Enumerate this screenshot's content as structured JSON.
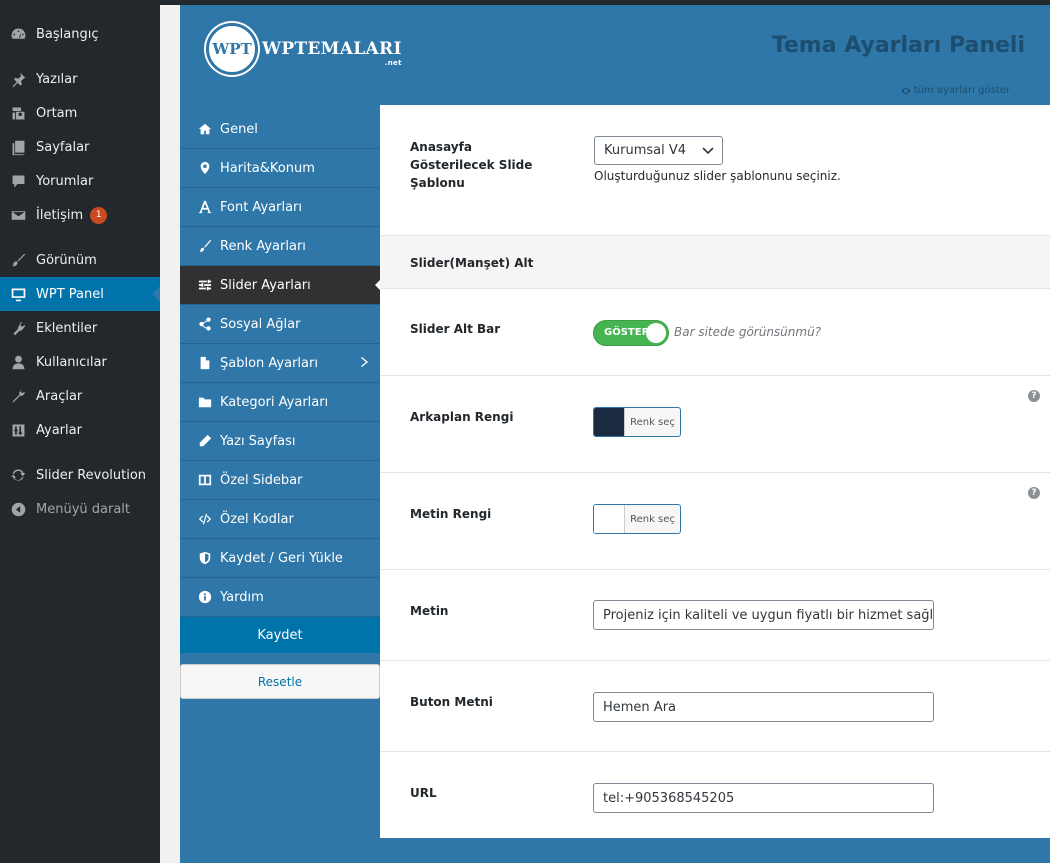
{
  "colors": {
    "wp_sidebar": "#23282d",
    "wp_active": "#0073aa",
    "panel": "#2e77a8",
    "nav_active": "#2f3133",
    "badge": "#ca4a1f",
    "toggle_on": "#46b450",
    "bg_swatch": "#1b2a40",
    "text_swatch": "#ffffff"
  },
  "wp_menu": [
    {
      "label": "Başlangıç",
      "icon": "dashboard-icon"
    },
    {
      "label": "Yazılar",
      "icon": "pin-icon"
    },
    {
      "label": "Ortam",
      "icon": "media-icon"
    },
    {
      "label": "Sayfalar",
      "icon": "pages-icon"
    },
    {
      "label": "Yorumlar",
      "icon": "comment-icon"
    },
    {
      "label": "İletişim",
      "icon": "mail-icon",
      "badge": "1"
    },
    {
      "label": "Görünüm",
      "icon": "brush-icon"
    },
    {
      "label": "WPT Panel",
      "icon": "monitor-icon"
    },
    {
      "label": "Eklentiler",
      "icon": "plugin-icon"
    },
    {
      "label": "Kullanıcılar",
      "icon": "user-icon"
    },
    {
      "label": "Araçlar",
      "icon": "wrench-icon"
    },
    {
      "label": "Ayarlar",
      "icon": "settings-icon"
    },
    {
      "label": "Slider Revolution",
      "icon": "refresh-icon"
    },
    {
      "label": "Menüyü daralt",
      "icon": "collapse-icon"
    }
  ],
  "header": {
    "logo_mark": "WPT",
    "logo_text": "WPTEMALARI",
    "logo_net": ".net",
    "title": "Tema Ayarları Paneli",
    "show_all": "tüm ayarları göster"
  },
  "plugin_nav": [
    {
      "label": "Genel",
      "icon": "home-icon"
    },
    {
      "label": "Harita&Konum",
      "icon": "map-marker-icon"
    },
    {
      "label": "Font Ayarları",
      "icon": "font-icon"
    },
    {
      "label": "Renk Ayarları",
      "icon": "paint-brush-icon"
    },
    {
      "label": "Slider Ayarları",
      "icon": "sliders-icon"
    },
    {
      "label": "Sosyal Ağlar",
      "icon": "share-icon"
    },
    {
      "label": "Şablon Ayarları",
      "icon": "file-icon"
    },
    {
      "label": "Kategori Ayarları",
      "icon": "folder-icon"
    },
    {
      "label": "Yazı Sayfası",
      "icon": "pencil-icon"
    },
    {
      "label": "Özel Sidebar",
      "icon": "columns-icon"
    },
    {
      "label": "Özel Kodlar",
      "icon": "code-icon"
    },
    {
      "label": "Kaydet / Geri Yükle",
      "icon": "shield-icon"
    },
    {
      "label": "Yardım",
      "icon": "info-icon"
    }
  ],
  "buttons": {
    "save": "Kaydet",
    "reset": "Resetle"
  },
  "settings": {
    "template": {
      "label": "Anasayfa Gösterilecek Slide Şablonu",
      "value": "Kurumsal V4",
      "description": "Oluşturduğunuz slider şablonunu seçiniz."
    },
    "section_title": "Slider(Manşet) Alt",
    "alt_bar": {
      "label": "Slider Alt Bar",
      "toggle": "GÖSTER",
      "description": "Bar sitede görünsünmü?"
    },
    "bg_color": {
      "label": "Arkaplan Rengi",
      "button": "Renk seç"
    },
    "text_color": {
      "label": "Metin Rengi",
      "button": "Renk seç"
    },
    "text": {
      "label": "Metin",
      "value": "Projeniz için kaliteli ve uygun fiyatlı bir hizmet sağlay"
    },
    "button_text": {
      "label": "Buton Metni",
      "value": "Hemen Ara"
    },
    "url": {
      "label": "URL",
      "value": "tel:+905368545205"
    }
  }
}
